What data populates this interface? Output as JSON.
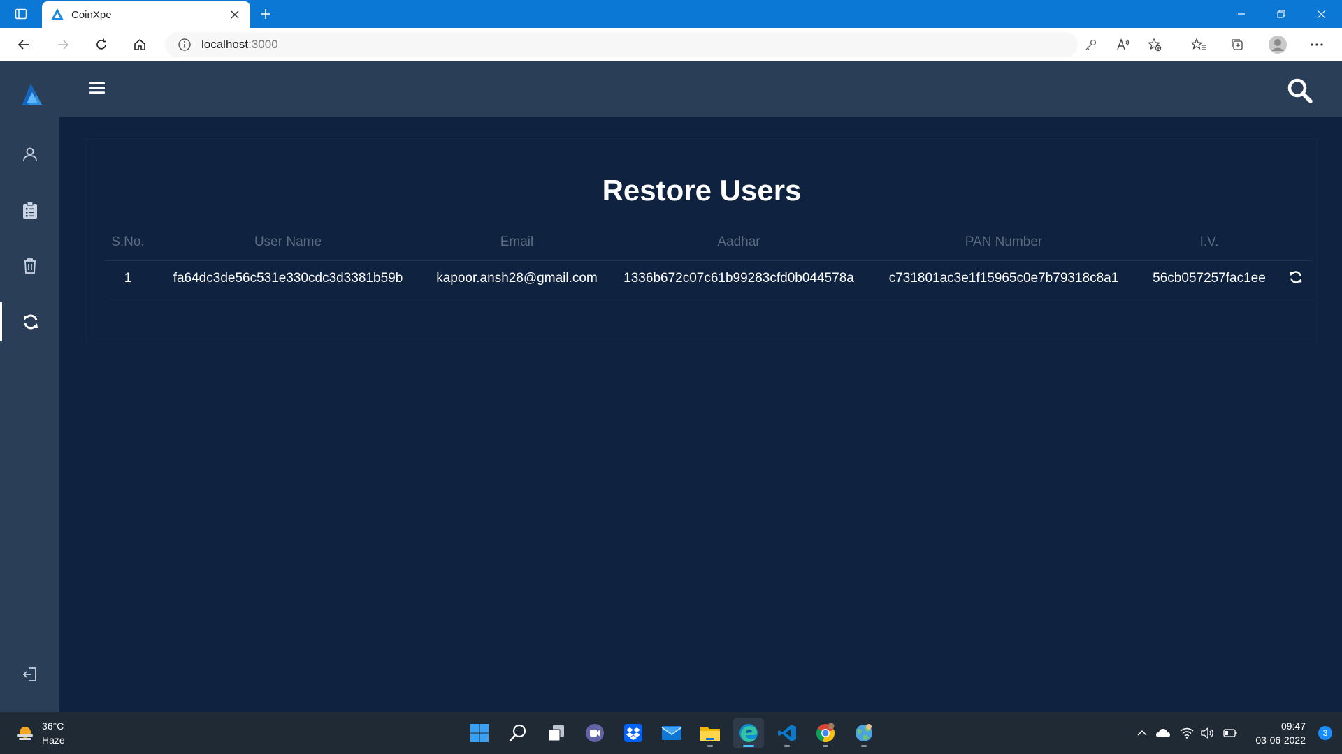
{
  "browser": {
    "tab_title": "CoinXpe",
    "url_host": "localhost",
    "url_port": ":3000"
  },
  "sidebar": {
    "items": [
      {
        "name": "users",
        "icon": "user-icon",
        "active": false
      },
      {
        "name": "reports",
        "icon": "clipboard-icon",
        "active": false
      },
      {
        "name": "deleted",
        "icon": "trash-icon",
        "active": false
      },
      {
        "name": "restore",
        "icon": "sync-icon",
        "active": true
      }
    ],
    "logout_icon": "logout-icon"
  },
  "page": {
    "title": "Restore Users"
  },
  "table": {
    "headers": [
      "S.No.",
      "User Name",
      "Email",
      "Aadhar",
      "PAN Number",
      "I.V."
    ],
    "rows": [
      {
        "sno": "1",
        "username": "fa64dc3de56c531e330cdc3d3381b59b",
        "email": "kapoor.ansh28@gmail.com",
        "aadhar": "1336b672c07c61b99283cfd0b044578a",
        "pan": "c731801ac3e1f15965c0e7b79318c8a1",
        "iv": "56cb057257fac1ee"
      }
    ]
  },
  "taskbar": {
    "weather_temp": "36°C",
    "weather_desc": "Haze",
    "time": "09:47",
    "date": "03-06-2022",
    "notification_count": "3"
  },
  "colors": {
    "sidebar_bg": "#2b3e58",
    "content_bg": "#0f2240",
    "browser_accent": "#0a78d4",
    "header_text": "#5b6b80"
  }
}
